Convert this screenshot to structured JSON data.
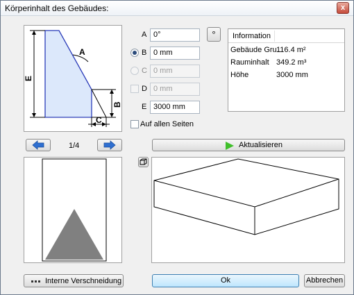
{
  "window": {
    "title": "Körperinhalt des Gebäudes:",
    "close_label": "x"
  },
  "fields": [
    {
      "label": "A",
      "value": "0°",
      "enabled": true
    },
    {
      "label": "B",
      "value": "0 mm",
      "enabled": true
    },
    {
      "label": "C",
      "value": "0 mm",
      "enabled": false
    },
    {
      "label": "D",
      "value": "0 mm",
      "enabled": false
    },
    {
      "label": "E",
      "value": "3000 mm",
      "enabled": true
    }
  ],
  "degree_button_label": "°",
  "all_sides_label": "Auf allen Seiten",
  "info": {
    "header": "Information",
    "rows": [
      {
        "name": "Gebäude Gru...",
        "value": "116.4 m²"
      },
      {
        "name": "Rauminhalt",
        "value": "349.2 m³"
      },
      {
        "name": "Höhe",
        "value": "3000 mm"
      }
    ]
  },
  "diagram_labels": {
    "a": "A",
    "b": "B",
    "c": "C",
    "e": "E"
  },
  "pager": {
    "text": "1/4"
  },
  "update_button_label": "Aktualisieren",
  "footer": {
    "intersect_label": "Interne Verschneidung",
    "ok_label": "Ok",
    "cancel_label": "Abbrechen"
  },
  "colors": {
    "shape_fill": "#dce8fb",
    "shape_stroke": "#2a3bb8",
    "arrow_blue": "#2e6fd1",
    "play_green": "#3fbf2a",
    "triangle_gray": "#808080"
  }
}
